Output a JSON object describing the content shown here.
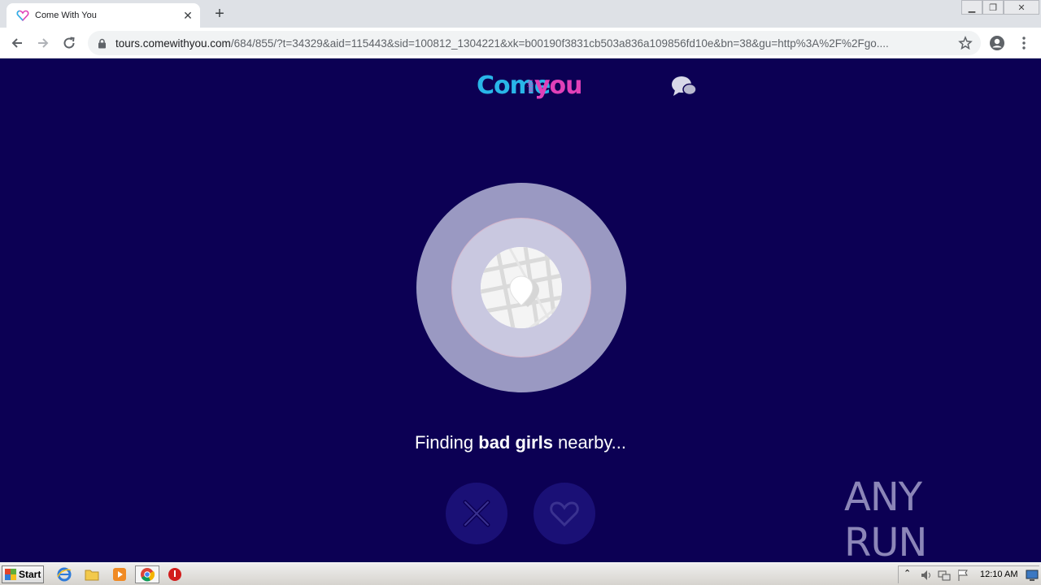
{
  "browser": {
    "tab_title": "Come With You",
    "url_host": "tours.comewithyou.com",
    "url_rest": "/684/855/?t=34329&aid=115443&sid=100812_1304221&xk=b00190f3831cb503a836a109856fd10e&bn=38&gu=http%3A%2F%2Fgo....",
    "icons": [
      "heart-favicon-icon",
      "close-icon",
      "plus-icon",
      "back-arrow-icon",
      "forward-arrow-icon",
      "reload-icon",
      "lock-icon",
      "star-icon",
      "account-icon",
      "menu-dots-icon",
      "minimize-icon",
      "restore-icon",
      "window-close-icon"
    ]
  },
  "page": {
    "logo_part1": "Come",
    "logo_part2": "with",
    "logo_part3": "you",
    "finding_prefix": "Finding ",
    "finding_bold": "bad girls",
    "finding_suffix": " nearby...",
    "icons": [
      "chat-bubbles-icon",
      "map-pin-icon",
      "dislike-x-icon",
      "like-heart-icon"
    ],
    "colors": {
      "background": "#0c0054",
      "logo_blue": "#29b6e8",
      "logo_pink": "#e040b8"
    }
  },
  "watermark": {
    "text": "ANY RUN"
  },
  "taskbar": {
    "start_label": "Start",
    "clock": "12:10 AM",
    "icons": [
      "internet-explorer-icon",
      "folder-icon",
      "media-player-icon",
      "chrome-icon",
      "stop-icon",
      "tray-arrow-icon",
      "volume-icon",
      "network-icon",
      "flag-icon",
      "desktop-icon"
    ]
  }
}
